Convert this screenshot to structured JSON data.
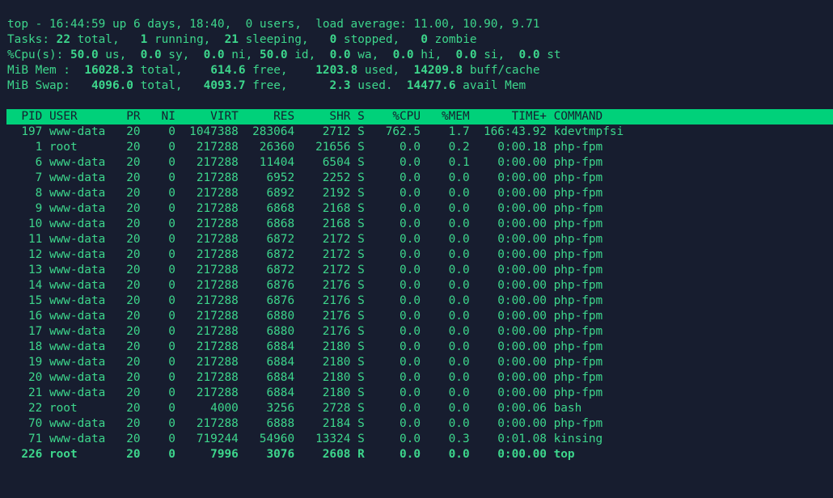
{
  "summary": {
    "line1": "top - 16:44:59 up 6 days, 18:40,  0 users,  load average: 11.00, 10.90, 9.71",
    "tasks": [
      {
        "t": "Tasks: ",
        "b": false
      },
      {
        "t": "22",
        "b": true
      },
      {
        "t": " total,   ",
        "b": false
      },
      {
        "t": "1",
        "b": true
      },
      {
        "t": " running,  ",
        "b": false
      },
      {
        "t": "21",
        "b": true
      },
      {
        "t": " sleeping,   ",
        "b": false
      },
      {
        "t": "0",
        "b": true
      },
      {
        "t": " stopped,   ",
        "b": false
      },
      {
        "t": "0",
        "b": true
      },
      {
        "t": " zombie",
        "b": false
      }
    ],
    "cpu": [
      {
        "t": "%Cpu(s): ",
        "b": false
      },
      {
        "t": "50.0",
        "b": true
      },
      {
        "t": " us,  ",
        "b": false
      },
      {
        "t": "0.0",
        "b": true
      },
      {
        "t": " sy,  ",
        "b": false
      },
      {
        "t": "0.0",
        "b": true
      },
      {
        "t": " ni, ",
        "b": false
      },
      {
        "t": "50.0",
        "b": true
      },
      {
        "t": " id,  ",
        "b": false
      },
      {
        "t": "0.0",
        "b": true
      },
      {
        "t": " wa,  ",
        "b": false
      },
      {
        "t": "0.0",
        "b": true
      },
      {
        "t": " hi,  ",
        "b": false
      },
      {
        "t": "0.0",
        "b": true
      },
      {
        "t": " si,  ",
        "b": false
      },
      {
        "t": "0.0",
        "b": true
      },
      {
        "t": " st",
        "b": false
      }
    ],
    "mem": [
      {
        "t": "MiB Mem :  ",
        "b": false
      },
      {
        "t": "16028.3",
        "b": true
      },
      {
        "t": " total,    ",
        "b": false
      },
      {
        "t": "614.6",
        "b": true
      },
      {
        "t": " free,    ",
        "b": false
      },
      {
        "t": "1203.8",
        "b": true
      },
      {
        "t": " used,  ",
        "b": false
      },
      {
        "t": "14209.8",
        "b": true
      },
      {
        "t": " buff/cache",
        "b": false
      }
    ],
    "swap": [
      {
        "t": "MiB Swap:   ",
        "b": false
      },
      {
        "t": "4096.0",
        "b": true
      },
      {
        "t": " total,   ",
        "b": false
      },
      {
        "t": "4093.7",
        "b": true
      },
      {
        "t": " free,      ",
        "b": false
      },
      {
        "t": "2.3",
        "b": true
      },
      {
        "t": " used.  ",
        "b": false
      },
      {
        "t": "14477.6",
        "b": true
      },
      {
        "t": " avail Mem",
        "b": false
      }
    ]
  },
  "table": {
    "columns": [
      "PID",
      "USER",
      "PR",
      "NI",
      "VIRT",
      "RES",
      "SHR",
      "S",
      "%CPU",
      "%MEM",
      "TIME+",
      "COMMAND"
    ],
    "rows": [
      [
        "197",
        "www-data",
        "20",
        "0",
        "1047388",
        "283064",
        "2712",
        "S",
        "762.5",
        "1.7",
        "166:43.92",
        "kdevtmpfsi"
      ],
      [
        "1",
        "root",
        "20",
        "0",
        "217288",
        "26360",
        "21656",
        "S",
        "0.0",
        "0.2",
        "0:00.18",
        "php-fpm"
      ],
      [
        "6",
        "www-data",
        "20",
        "0",
        "217288",
        "11404",
        "6504",
        "S",
        "0.0",
        "0.1",
        "0:00.00",
        "php-fpm"
      ],
      [
        "7",
        "www-data",
        "20",
        "0",
        "217288",
        "6952",
        "2252",
        "S",
        "0.0",
        "0.0",
        "0:00.00",
        "php-fpm"
      ],
      [
        "8",
        "www-data",
        "20",
        "0",
        "217288",
        "6892",
        "2192",
        "S",
        "0.0",
        "0.0",
        "0:00.00",
        "php-fpm"
      ],
      [
        "9",
        "www-data",
        "20",
        "0",
        "217288",
        "6868",
        "2168",
        "S",
        "0.0",
        "0.0",
        "0:00.00",
        "php-fpm"
      ],
      [
        "10",
        "www-data",
        "20",
        "0",
        "217288",
        "6868",
        "2168",
        "S",
        "0.0",
        "0.0",
        "0:00.00",
        "php-fpm"
      ],
      [
        "11",
        "www-data",
        "20",
        "0",
        "217288",
        "6872",
        "2172",
        "S",
        "0.0",
        "0.0",
        "0:00.00",
        "php-fpm"
      ],
      [
        "12",
        "www-data",
        "20",
        "0",
        "217288",
        "6872",
        "2172",
        "S",
        "0.0",
        "0.0",
        "0:00.00",
        "php-fpm"
      ],
      [
        "13",
        "www-data",
        "20",
        "0",
        "217288",
        "6872",
        "2172",
        "S",
        "0.0",
        "0.0",
        "0:00.00",
        "php-fpm"
      ],
      [
        "14",
        "www-data",
        "20",
        "0",
        "217288",
        "6876",
        "2176",
        "S",
        "0.0",
        "0.0",
        "0:00.00",
        "php-fpm"
      ],
      [
        "15",
        "www-data",
        "20",
        "0",
        "217288",
        "6876",
        "2176",
        "S",
        "0.0",
        "0.0",
        "0:00.00",
        "php-fpm"
      ],
      [
        "16",
        "www-data",
        "20",
        "0",
        "217288",
        "6880",
        "2176",
        "S",
        "0.0",
        "0.0",
        "0:00.00",
        "php-fpm"
      ],
      [
        "17",
        "www-data",
        "20",
        "0",
        "217288",
        "6880",
        "2176",
        "S",
        "0.0",
        "0.0",
        "0:00.00",
        "php-fpm"
      ],
      [
        "18",
        "www-data",
        "20",
        "0",
        "217288",
        "6884",
        "2180",
        "S",
        "0.0",
        "0.0",
        "0:00.00",
        "php-fpm"
      ],
      [
        "19",
        "www-data",
        "20",
        "0",
        "217288",
        "6884",
        "2180",
        "S",
        "0.0",
        "0.0",
        "0:00.00",
        "php-fpm"
      ],
      [
        "20",
        "www-data",
        "20",
        "0",
        "217288",
        "6884",
        "2180",
        "S",
        "0.0",
        "0.0",
        "0:00.00",
        "php-fpm"
      ],
      [
        "21",
        "www-data",
        "20",
        "0",
        "217288",
        "6884",
        "2180",
        "S",
        "0.0",
        "0.0",
        "0:00.00",
        "php-fpm"
      ],
      [
        "22",
        "root",
        "20",
        "0",
        "4000",
        "3256",
        "2728",
        "S",
        "0.0",
        "0.0",
        "0:00.06",
        "bash"
      ],
      [
        "70",
        "www-data",
        "20",
        "0",
        "217288",
        "6888",
        "2184",
        "S",
        "0.0",
        "0.0",
        "0:00.00",
        "php-fpm"
      ],
      [
        "71",
        "www-data",
        "20",
        "0",
        "719244",
        "54960",
        "13324",
        "S",
        "0.0",
        "0.3",
        "0:01.08",
        "kinsing"
      ],
      [
        "226",
        "root",
        "20",
        "0",
        "7996",
        "3076",
        "2608",
        "R",
        "0.0",
        "0.0",
        "0:00.00",
        "top"
      ]
    ],
    "highlighted_row": "226"
  },
  "colors": {
    "background": "#171d2f",
    "text": "#3dd68c",
    "header_bar": "#00d17a"
  }
}
